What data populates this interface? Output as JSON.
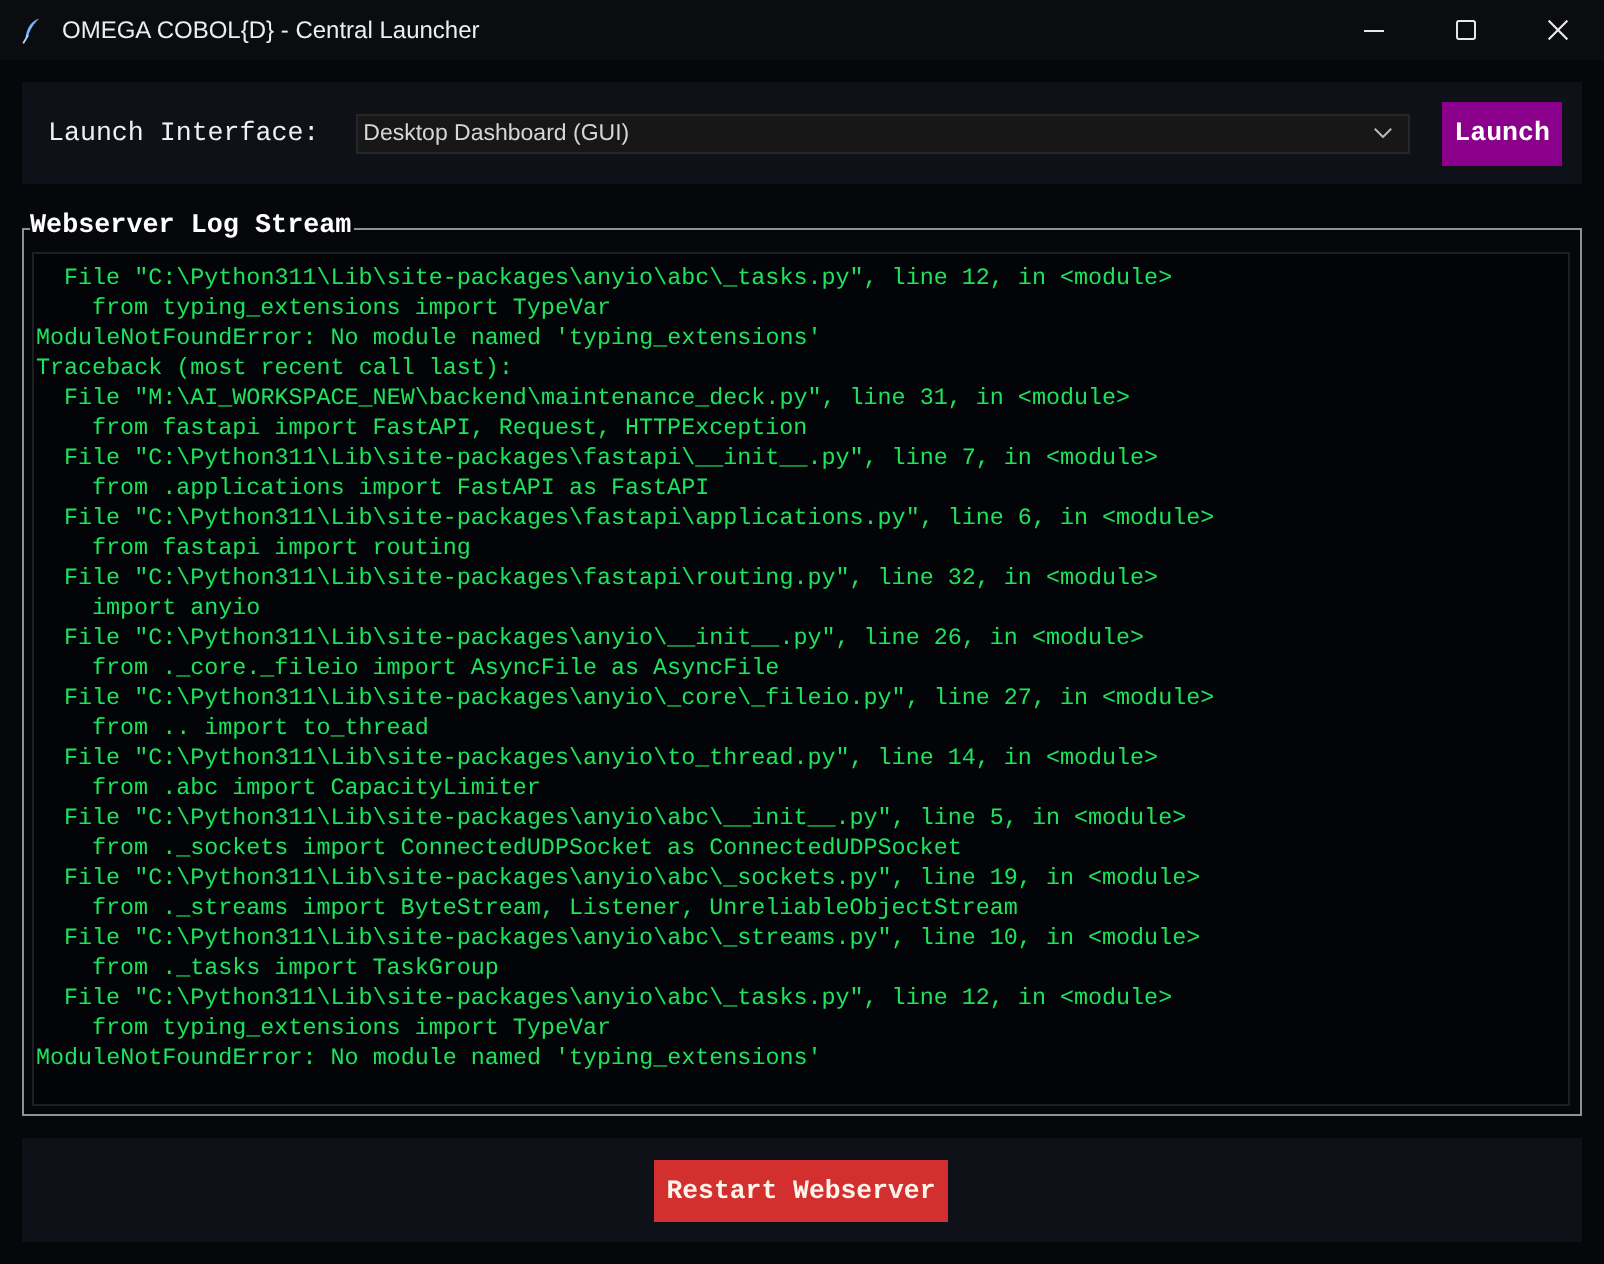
{
  "window": {
    "title": "OMEGA COBOL{D} - Central Launcher"
  },
  "launcher": {
    "label": "Launch Interface:",
    "dropdown": {
      "value": "Desktop Dashboard (GUI)"
    },
    "button": "Launch"
  },
  "log": {
    "title": "Webserver Log Stream",
    "lines": [
      {
        "kind": "frame",
        "text": "File \"C:\\Python311\\Lib\\site-packages\\anyio\\abc\\_tasks.py\", line 12, in <module>"
      },
      {
        "kind": "code",
        "text": "from typing_extensions import TypeVar"
      },
      {
        "kind": "plain",
        "text": "ModuleNotFoundError: No module named 'typing_extensions'"
      },
      {
        "kind": "plain",
        "text": "Traceback (most recent call last):"
      },
      {
        "kind": "frame",
        "text": "File \"M:\\AI_WORKSPACE_NEW\\backend\\maintenance_deck.py\", line 31, in <module>"
      },
      {
        "kind": "code",
        "text": "from fastapi import FastAPI, Request, HTTPException"
      },
      {
        "kind": "frame",
        "text": "File \"C:\\Python311\\Lib\\site-packages\\fastapi\\__init__.py\", line 7, in <module>"
      },
      {
        "kind": "code",
        "text": "from .applications import FastAPI as FastAPI"
      },
      {
        "kind": "frame",
        "text": "File \"C:\\Python311\\Lib\\site-packages\\fastapi\\applications.py\", line 6, in <module>"
      },
      {
        "kind": "code",
        "text": "from fastapi import routing"
      },
      {
        "kind": "frame",
        "text": "File \"C:\\Python311\\Lib\\site-packages\\fastapi\\routing.py\", line 32, in <module>"
      },
      {
        "kind": "code",
        "text": "import anyio"
      },
      {
        "kind": "frame",
        "text": "File \"C:\\Python311\\Lib\\site-packages\\anyio\\__init__.py\", line 26, in <module>"
      },
      {
        "kind": "code",
        "text": "from ._core._fileio import AsyncFile as AsyncFile"
      },
      {
        "kind": "frame",
        "text": "File \"C:\\Python311\\Lib\\site-packages\\anyio\\_core\\_fileio.py\", line 27, in <module>"
      },
      {
        "kind": "code",
        "text": "from .. import to_thread"
      },
      {
        "kind": "frame",
        "text": "File \"C:\\Python311\\Lib\\site-packages\\anyio\\to_thread.py\", line 14, in <module>"
      },
      {
        "kind": "code",
        "text": "from .abc import CapacityLimiter"
      },
      {
        "kind": "frame",
        "text": "File \"C:\\Python311\\Lib\\site-packages\\anyio\\abc\\__init__.py\", line 5, in <module>"
      },
      {
        "kind": "code",
        "text": "from ._sockets import ConnectedUDPSocket as ConnectedUDPSocket"
      },
      {
        "kind": "frame",
        "text": "File \"C:\\Python311\\Lib\\site-packages\\anyio\\abc\\_sockets.py\", line 19, in <module>"
      },
      {
        "kind": "code",
        "text": "from ._streams import ByteStream, Listener, UnreliableObjectStream"
      },
      {
        "kind": "frame",
        "text": "File \"C:\\Python311\\Lib\\site-packages\\anyio\\abc\\_streams.py\", line 10, in <module>"
      },
      {
        "kind": "code",
        "text": "from ._tasks import TaskGroup"
      },
      {
        "kind": "frame",
        "text": "File \"C:\\Python311\\Lib\\site-packages\\anyio\\abc\\_tasks.py\", line 12, in <module>"
      },
      {
        "kind": "code",
        "text": "from typing_extensions import TypeVar"
      },
      {
        "kind": "plain",
        "text": "ModuleNotFoundError: No module named 'typing_extensions'"
      }
    ]
  },
  "footer": {
    "button": "Restart Webserver"
  }
}
